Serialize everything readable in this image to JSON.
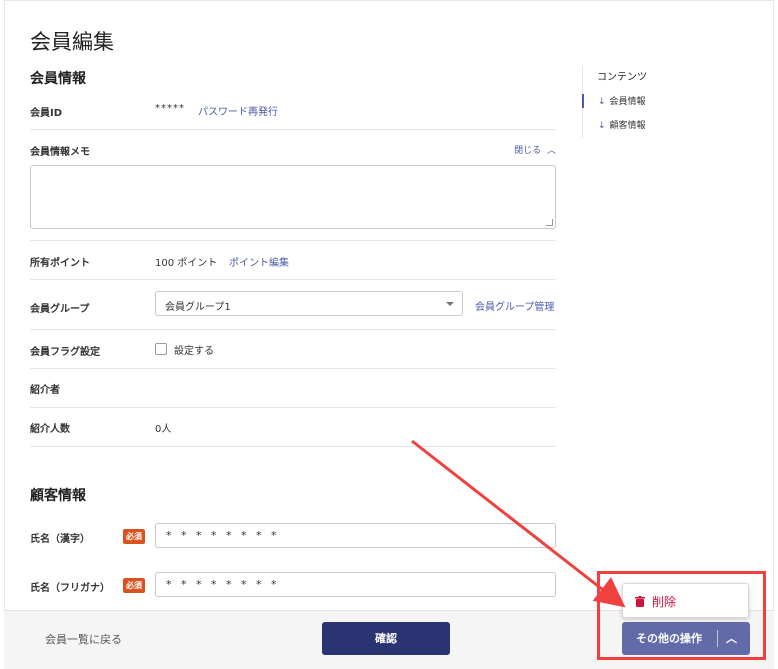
{
  "page": {
    "title": "会員編集"
  },
  "sections": {
    "member_info": {
      "title": "会員情報"
    },
    "customer_info": {
      "title": "顧客情報"
    }
  },
  "member": {
    "id_label": "会員ID",
    "id_value": "*****",
    "password_reset_link": "パスワード再発行",
    "memo_label": "会員情報メモ",
    "memo_toggle": "閉じる",
    "memo_value": "",
    "points_label": "所有ポイント",
    "points_value": "100 ポイント",
    "points_edit_link": "ポイント編集",
    "group_label": "会員グループ",
    "group_value": "会員グループ1",
    "group_manage_link": "会員グループ管理",
    "flag_label": "会員フラグ設定",
    "flag_checkbox_label": "設定する",
    "referrer_label": "紹介者",
    "referrer_value": "",
    "referral_count_label": "紹介人数",
    "referral_count_value": "0人"
  },
  "customer": {
    "name_kanji_label": "氏名（漢字）",
    "name_kanji_value": "* * * * * * * *",
    "name_kana_label": "氏名（フリガナ）",
    "name_kana_value": "* * * * * * * *",
    "required_badge": "必須"
  },
  "toc": {
    "title": "コンテンツ",
    "items": [
      {
        "label": "会員情報",
        "active": true
      },
      {
        "label": "顧客情報",
        "active": false
      }
    ]
  },
  "footer": {
    "back_link": "会員一覧に戻る",
    "confirm_label": "確認",
    "more_actions_label": "その他の操作",
    "menu_items": [
      {
        "label": "削除",
        "icon": "trash-icon"
      }
    ]
  },
  "colors": {
    "primary": "#2b3472",
    "secondary_button": "#636aa8",
    "link": "#4a5aa8",
    "required": "#d9531e",
    "danger": "#d0143c",
    "annotation": "#f04040"
  }
}
